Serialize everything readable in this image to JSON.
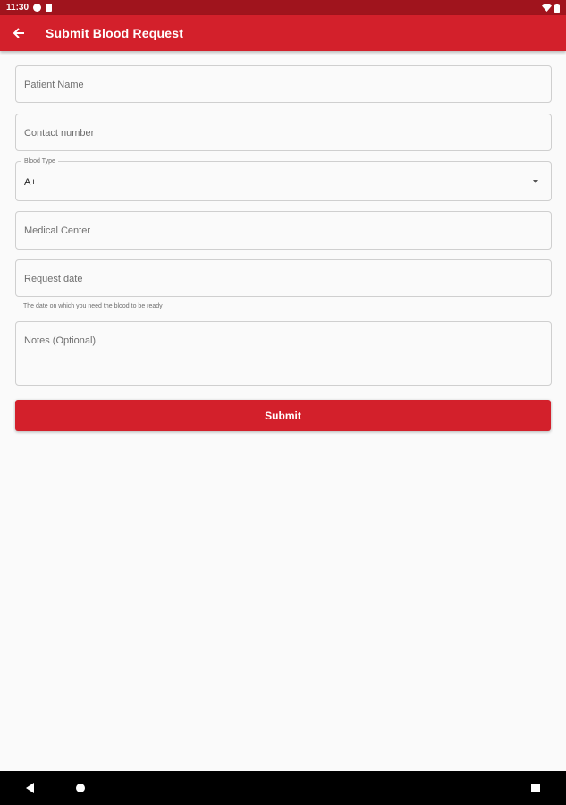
{
  "status_bar": {
    "time": "11:30",
    "icons": [
      "notification-icon",
      "sim-card-icon",
      "wifi-icon",
      "battery-icon"
    ]
  },
  "app_bar": {
    "title": "Submit Blood Request",
    "back_icon": "arrow-left-icon",
    "color": "#d3202b"
  },
  "form": {
    "patient_name": {
      "placeholder": "Patient Name"
    },
    "contact_number": {
      "placeholder": "Contact number"
    },
    "blood_type": {
      "label": "Blood Type",
      "value": "A+"
    },
    "medical_center": {
      "placeholder": "Medical Center"
    },
    "request_date": {
      "placeholder": "Request date",
      "helper": "The date on which you need the blood to be ready"
    },
    "notes": {
      "placeholder": "Notes (Optional)"
    },
    "submit_label": "Submit"
  },
  "nav_bar": {
    "icons": [
      "back-triangle-icon",
      "home-circle-icon",
      "recents-square-icon"
    ]
  }
}
